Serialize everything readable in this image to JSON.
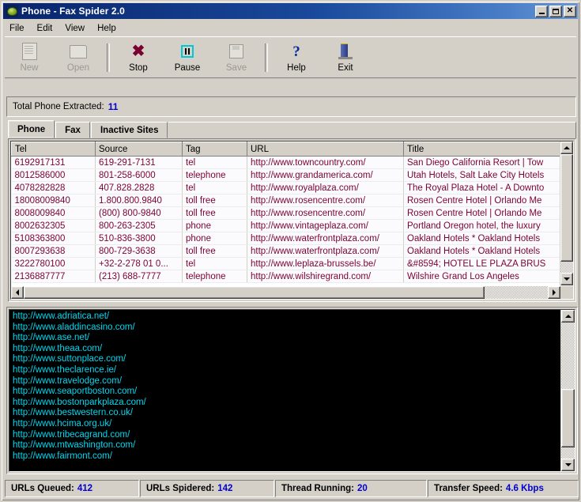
{
  "window": {
    "title": "Phone - Fax Spider 2.0",
    "icon": "spider-icon",
    "minimize_label": "_",
    "maximize_label": "□",
    "close_label": "✕"
  },
  "menu": {
    "items": [
      {
        "label": "File"
      },
      {
        "label": "Edit"
      },
      {
        "label": "View"
      },
      {
        "label": "Help"
      }
    ]
  },
  "toolbar": {
    "buttons": [
      {
        "label": "New",
        "icon": "new-document-icon",
        "enabled": false
      },
      {
        "label": "Open",
        "icon": "open-folder-icon",
        "enabled": false
      },
      {
        "label": "Stop",
        "icon": "stop-x-icon",
        "enabled": true
      },
      {
        "label": "Pause",
        "icon": "pause-icon",
        "enabled": true
      },
      {
        "label": "Save",
        "icon": "save-disk-icon",
        "enabled": false
      },
      {
        "label": "Help",
        "icon": "question-mark-icon",
        "enabled": true
      },
      {
        "label": "Exit",
        "icon": "exit-door-icon",
        "enabled": true
      }
    ]
  },
  "summary": {
    "label": "Total Phone Extracted:",
    "value": "11"
  },
  "tabs": [
    {
      "label": "Phone",
      "active": true
    },
    {
      "label": "Fax",
      "active": false
    },
    {
      "label": "Inactive Sites",
      "active": false
    }
  ],
  "grid": {
    "columns": [
      "Tel",
      "Source",
      "Tag",
      "URL",
      "Title"
    ],
    "rows": [
      [
        "6192917131",
        "619-291-7131",
        "tel",
        "http://www.towncountry.com/",
        "San Diego California Resort | Tow"
      ],
      [
        "8012586000",
        "801-258-6000",
        "telephone",
        "http://www.grandamerica.com/",
        "Utah Hotels, Salt Lake City Hotels"
      ],
      [
        "4078282828",
        "407.828.2828",
        "tel",
        "http://www.royalplaza.com/",
        "The Royal Plaza Hotel - A Downto"
      ],
      [
        "18008009840",
        "1.800.800.9840",
        "toll free",
        "http://www.rosencentre.com/",
        "Rosen Centre Hotel | Orlando Me"
      ],
      [
        "8008009840",
        "(800) 800-9840",
        "toll free",
        "http://www.rosencentre.com/",
        "Rosen Centre Hotel | Orlando Me"
      ],
      [
        "8002632305",
        "800-263-2305",
        "phone",
        "http://www.vintageplaza.com/",
        "Portland Oregon hotel, the luxury "
      ],
      [
        "5108363800",
        "510-836-3800",
        "phone",
        "http://www.waterfrontplaza.com/",
        "Oakland Hotels * Oakland Hotels"
      ],
      [
        "8007293638",
        "800-729-3638",
        "toll free",
        "http://www.waterfrontplaza.com/",
        "Oakland Hotels * Oakland Hotels"
      ],
      [
        "3222780100",
        "+32-2-278 01 0...",
        "tel",
        "http://www.leplaza-brussels.be/",
        "&#8594; HOTEL LE PLAZA BRUS"
      ],
      [
        "2136887777",
        "(213) 688-7777",
        "telephone",
        "http://www.wilshiregrand.com/",
        "Wilshire Grand Los Angeles"
      ]
    ]
  },
  "log": {
    "lines": [
      "http://www.adriatica.net/",
      "http://www.aladdincasino.com/",
      "http://www.ase.net/",
      "http://www.theaa.com/",
      "http://www.suttonplace.com/",
      "http://www.theclarence.ie/",
      "http://www.travelodge.com/",
      "http://www.seaportboston.com/",
      "http://www.bostonparkplaza.com/",
      "http://www.bestwestern.co.uk/",
      "http://www.hcima.org.uk/",
      "http://www.tribecagrand.com/",
      "http://www.mtwashington.com/",
      "http://www.fairmont.com/"
    ]
  },
  "status": {
    "cells": [
      {
        "label": "URLs Queued:",
        "value": "412"
      },
      {
        "label": "URLs Spidered:",
        "value": "142"
      },
      {
        "label": "Thread Running:",
        "value": "20"
      },
      {
        "label": "Transfer Speed:",
        "value": "4.6 Kbps"
      }
    ]
  },
  "colors": {
    "title_gradient_start": "#08246b",
    "face": "#d4d0c8",
    "grid_text": "#7d0033",
    "log_text": "#00d8f0",
    "accent_value": "#0000d0"
  }
}
